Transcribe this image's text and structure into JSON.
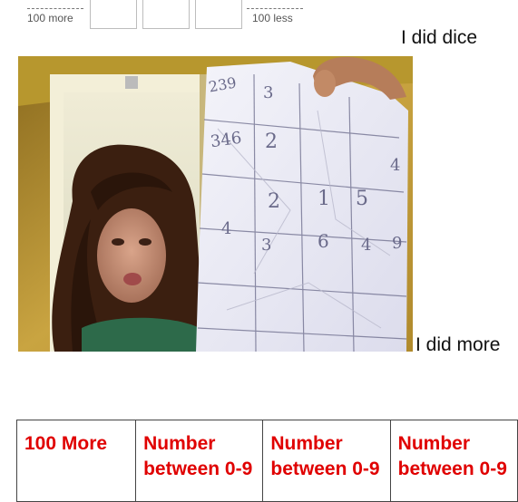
{
  "worksheet": {
    "label_100_more": "100 more",
    "label_100_less": "100 less"
  },
  "captions": {
    "dice": "I did dice",
    "more": "I did more"
  },
  "photo": {
    "description_icon": "webcam-photo",
    "paper_numbers": [
      "239",
      "3",
      "346",
      "2",
      "2",
      "1",
      "5",
      "4",
      "4",
      "3",
      "6",
      "4",
      "9"
    ]
  },
  "table": {
    "headers": [
      "100 More",
      "Number between 0-9",
      "Number between 0-9",
      "Number between 0-9"
    ]
  },
  "colors": {
    "header_red": "#e00000"
  }
}
